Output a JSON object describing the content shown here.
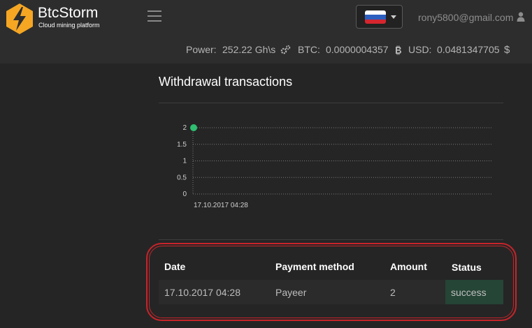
{
  "header": {
    "brand": "BtcStorm",
    "tagline": "Cloud mining platform",
    "user_email": "rony5800@gmail.com",
    "language_flag": "russia-flag",
    "colors": {
      "logo": "#f5a623",
      "accent_red": "#c8242a",
      "success_bg": "#254536"
    }
  },
  "stats": {
    "power_label": "Power:",
    "power_value": "252.22 Gh\\s",
    "btc_label": "BTC:",
    "btc_value": "0.0000004357",
    "usd_label": "USD:",
    "usd_value": "0.0481347705",
    "usd_symbol": "$"
  },
  "section": {
    "title": "Withdrawal transactions"
  },
  "chart_data": {
    "type": "line",
    "x": [
      "17.10.2017 04:28"
    ],
    "series": [
      {
        "values": [
          2
        ],
        "color": "#2fbf71"
      }
    ],
    "yticks": [
      "2",
      "1.5",
      "1",
      "0.5",
      "0"
    ],
    "ylim": [
      0,
      2
    ],
    "grid": true
  },
  "table": {
    "headers": [
      "Date",
      "Payment method",
      "Amount",
      "Status"
    ],
    "rows": [
      {
        "date": "17.10.2017 04:28",
        "method": "Payeer",
        "amount": "2",
        "status": "success"
      }
    ]
  }
}
